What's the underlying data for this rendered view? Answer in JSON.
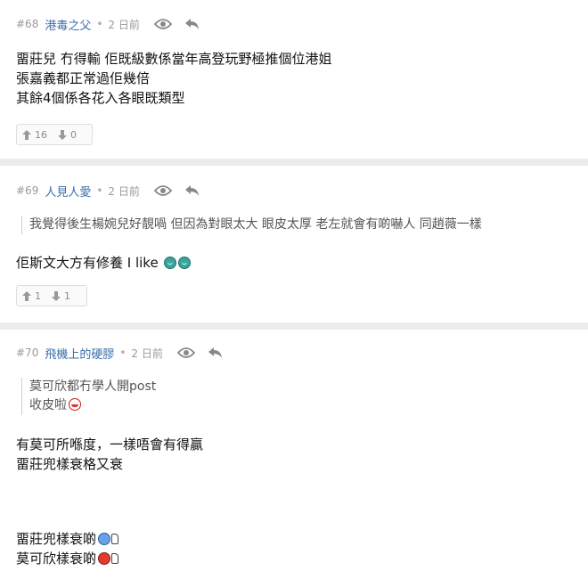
{
  "posts": [
    {
      "number": "#68",
      "username": "港毒之父",
      "dot": "•",
      "time": "2 日前",
      "lines": [
        "畱莊兒 冇得輸 佢既級數係當年高登玩野極推個位港姐",
        "張嘉義都正常過佢幾倍",
        "其餘4個係各花入各眼既類型"
      ],
      "upvotes": "16",
      "downvotes": "0"
    },
    {
      "number": "#69",
      "username": "人見人愛",
      "dot": "•",
      "time": "2 日前",
      "quote_lines": [
        "我覺得後生楊婉兒好靚喎 但因為對眼太大 眼皮太厚 老左就會有啲嚇人 同趙薇一樣"
      ],
      "line": "佢斯文大方有修養 I like",
      "upvotes": "1",
      "downvotes": "1"
    },
    {
      "number": "#70",
      "username": "飛機上的硬膠",
      "dot": "•",
      "time": "2 日前",
      "quote_lines": [
        "莫可欣都冇學人開post",
        "收皮啦"
      ],
      "lines_a": [
        "有莫可所喺度，一樣唔會有得贏",
        "畱莊兜樣衰格又衰"
      ],
      "lines_b": [
        "畱莊兜樣衰啲",
        "莫可欣樣衰啲"
      ]
    }
  ],
  "icons": {
    "views": "eye-icon",
    "reply": "reply-icon",
    "upvote": "thumb-up-icon",
    "downvote": "thumb-down-icon"
  },
  "colors": {
    "username": "#3a6ea8",
    "meta": "#9a9a9a",
    "separator": "#ececec"
  }
}
